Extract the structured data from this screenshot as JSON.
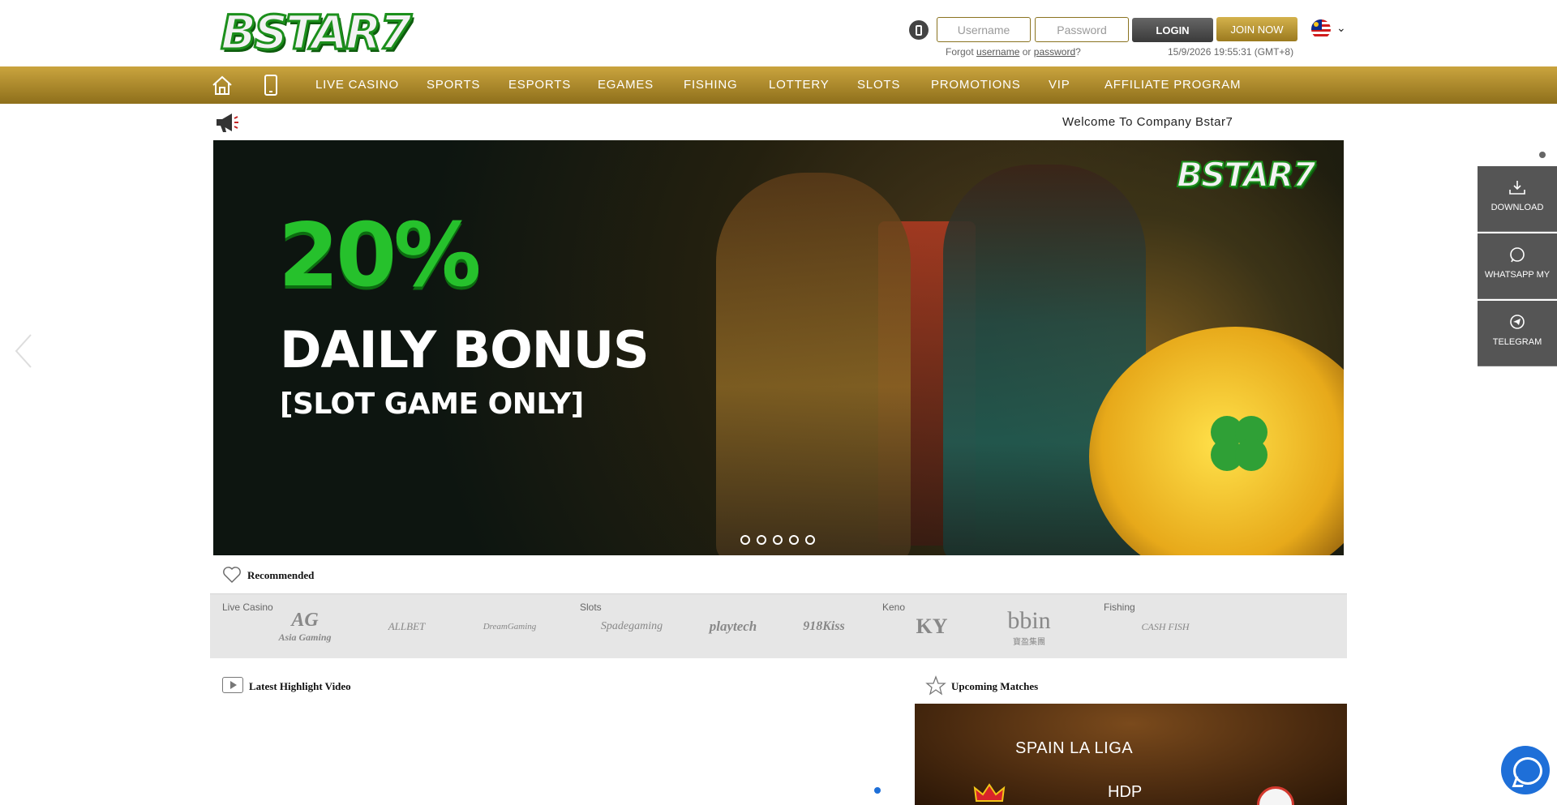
{
  "brand": {
    "logo_text": "BSTAR7"
  },
  "header": {
    "username_placeholder": "Username",
    "password_placeholder": "Password",
    "login_label": "LOGIN",
    "join_label": "JOIN NOW",
    "forgot_prefix": "Forgot",
    "forgot_username": "username",
    "forgot_or": "or",
    "forgot_password": "password",
    "forgot_suffix": "?",
    "datetime": "15/9/2026 19:55:31 (GMT+8)",
    "language_flag": "malaysia-flag-icon"
  },
  "nav": {
    "items": [
      "LIVE CASINO",
      "SPORTS",
      "ESPORTS",
      "EGAMES",
      "FISHING",
      "LOTTERY",
      "SLOTS",
      "PROMOTIONS",
      "VIP",
      "AFFILIATE PROGRAM"
    ]
  },
  "announcement": {
    "text": "Welcome To Company Bstar7"
  },
  "banner": {
    "logo": "BSTAR7",
    "percent": "20%",
    "title": "DAILY BONUS",
    "subtitle": "[SLOT GAME ONLY]",
    "slide_count": 5,
    "active_slide": 1
  },
  "floating": {
    "download": "DOWNLOAD",
    "whatsapp": "WHATSAPP MY",
    "telegram": "TELEGRAM"
  },
  "recommended": {
    "title": "Recommended",
    "categories": {
      "live_casino": "Live Casino",
      "slots": "Slots",
      "keno": "Keno",
      "fishing": "Fishing"
    },
    "providers": {
      "asia_gaming_mark": "AG",
      "asia_gaming": "Asia Gaming",
      "allbet": "ALLBET",
      "dreamgaming": "DreamGaming",
      "spadegaming": "Spadegaming",
      "playtech": "playtech",
      "kiss918": "918Kiss",
      "ky": "KY",
      "bbin": "bbin",
      "bbin_sub": "寶盈集團",
      "cashfish": "CASH FISH"
    }
  },
  "highlight": {
    "title": "Latest Highlight Video"
  },
  "matches": {
    "title": "Upcoming Matches",
    "league": "SPAIN LA LIGA",
    "market": "HDP"
  },
  "colors": {
    "gold": "#b8922e",
    "green": "#26c12c",
    "dark": "#555555",
    "accent_blue": "#1e6fd8"
  }
}
